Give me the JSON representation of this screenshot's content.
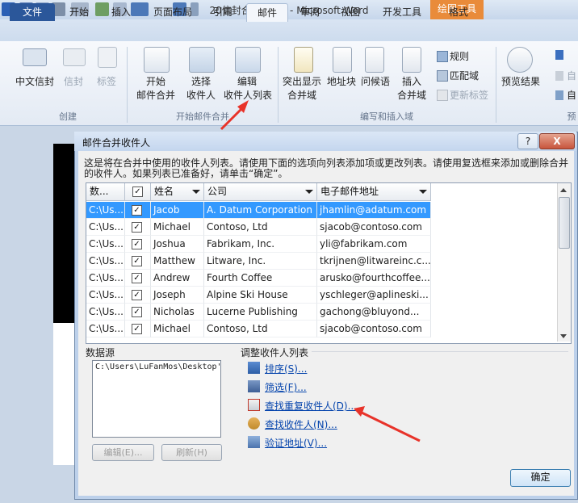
{
  "window": {
    "title": "20信封合并.docx - Microsoft Word",
    "context_tab": "绘图工具"
  },
  "tabs": [
    "文件",
    "开始",
    "插入",
    "页面布局",
    "引用",
    "邮件",
    "审阅",
    "视图",
    "开发工具",
    "格式"
  ],
  "ribbon": {
    "create": {
      "label": "创建",
      "envelope": "中文信封",
      "envelopes": "信封",
      "labels": "标签"
    },
    "start_merge": {
      "label": "开始邮件合并",
      "start_line1": "开始",
      "start_line2": "邮件合并",
      "select_line1": "选择",
      "select_line2": "收件人",
      "edit_line1": "编辑",
      "edit_line2": "收件人列表"
    },
    "write_insert": {
      "label": "编写和插入域",
      "highlight_line1": "突出显示",
      "highlight_line2": "合并域",
      "address_block": "地址块",
      "greeting": "问候语",
      "insert_line1": "插入",
      "insert_line2": "合并域",
      "rules": "规则",
      "match": "匹配域",
      "update": "更新标签"
    },
    "preview": {
      "preview_results": "预览结果",
      "auto_partial": "自",
      "group_partial": "预"
    }
  },
  "dialog": {
    "title": "邮件合并收件人",
    "help": "?",
    "close": "X",
    "instructions": "这是将在合并中使用的收件人列表。请使用下面的选项向列表添加项或更改列表。请使用复选框来添加或删除合并的收件人。如果列表已准备好，请单击“确定”。",
    "columns": [
      "数...",
      "",
      "姓名",
      "公司",
      "电子邮件地址"
    ],
    "rows": [
      {
        "source": "C:\\Us...",
        "checked": "✓",
        "name": "Jacob",
        "company": "A. Datum Corporation",
        "email": "jhamlin@adatum.com"
      },
      {
        "source": "C:\\Us...",
        "checked": "✓",
        "name": "Michael",
        "company": "Contoso, Ltd",
        "email": "sjacob@contoso.com"
      },
      {
        "source": "C:\\Us...",
        "checked": "✓",
        "name": "Joshua",
        "company": "Fabrikam, Inc.",
        "email": "yli@fabrikam.com"
      },
      {
        "source": "C:\\Us...",
        "checked": "✓",
        "name": "Matthew",
        "company": "Litware, Inc.",
        "email": "tkrijnen@litwareinc.c..."
      },
      {
        "source": "C:\\Us...",
        "checked": "✓",
        "name": "Andrew",
        "company": "Fourth Coffee",
        "email": "arusko@fourthcoffee..."
      },
      {
        "source": "C:\\Us...",
        "checked": "✓",
        "name": "Joseph",
        "company": "Alpine Ski House",
        "email": "yschleger@aplineski..."
      },
      {
        "source": "C:\\Us...",
        "checked": "✓",
        "name": "Nicholas",
        "company": "Lucerne Publishing",
        "email": "gachong@bluyond..."
      },
      {
        "source": "C:\\Us...",
        "checked": "✓",
        "name": "Michael",
        "company": "Contoso, Ltd",
        "email": "sjacob@contoso.com"
      }
    ],
    "data_source_label": "数据源",
    "data_source_item": "C:\\Users\\LuFanMos\\Desktop'",
    "edit_button": "编辑(E)...",
    "refresh_button": "刷新(H)",
    "adjust_label": "调整收件人列表",
    "links": {
      "sort": "排序(S)...",
      "filter": "筛选(F)...",
      "find_duplicates": "查找重复收件人(D)...",
      "find_recipient": "查找收件人(N)...",
      "validate": "验证地址(V)..."
    },
    "ok": "确定"
  },
  "colors": {
    "annotation_arrow": "#e8332a",
    "selection": "#3399ff",
    "file_tab": "#2b579a",
    "context_tab": "#e98b3a"
  }
}
